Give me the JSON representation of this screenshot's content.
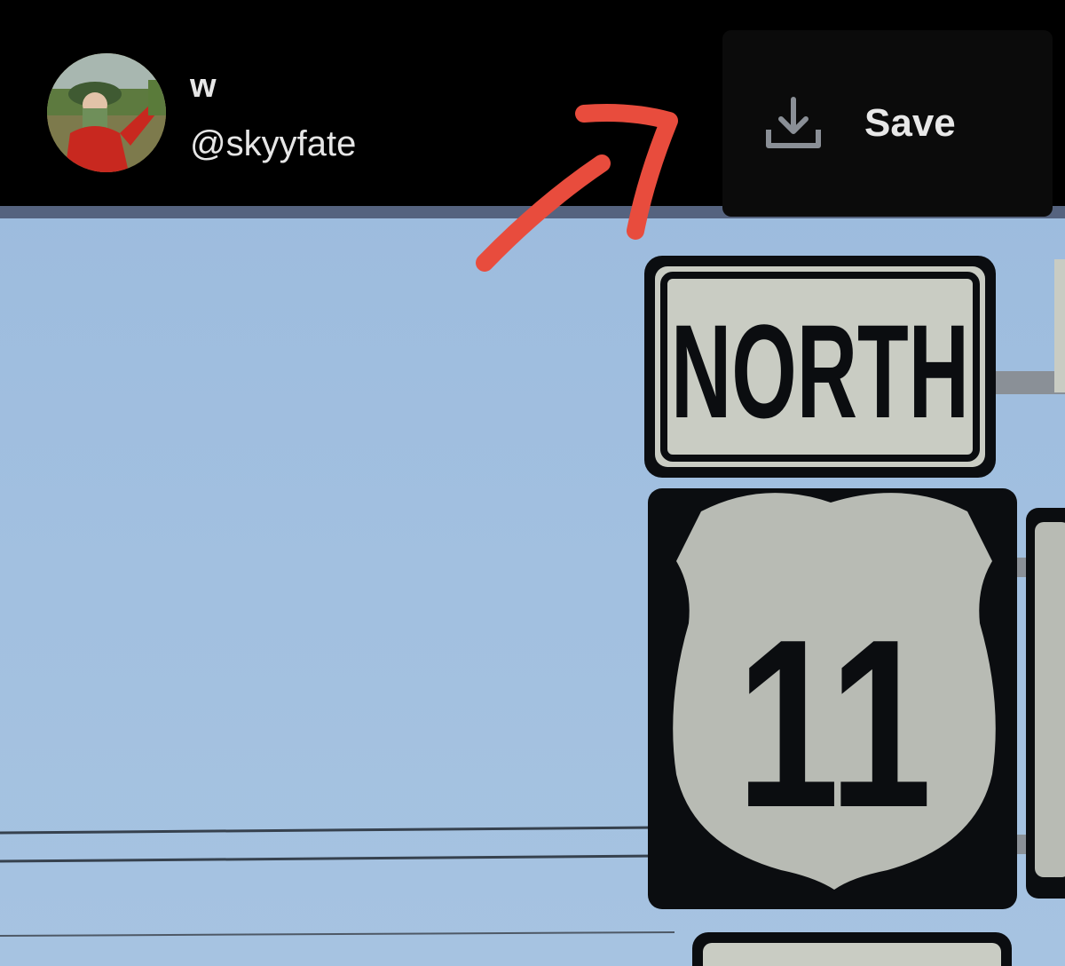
{
  "post": {
    "display_name": "w",
    "handle": "@skyyfate",
    "avatar_alt": "profile photo"
  },
  "save_menu": {
    "label": "Save",
    "icon": "download-icon"
  },
  "photo": {
    "sign_word": "NORTH",
    "route_number": "11"
  },
  "colors": {
    "topbar": "#000000",
    "menu_bg": "#0b0b0b",
    "annotation": "#e84c3d",
    "sky": "#a2c0e0"
  }
}
